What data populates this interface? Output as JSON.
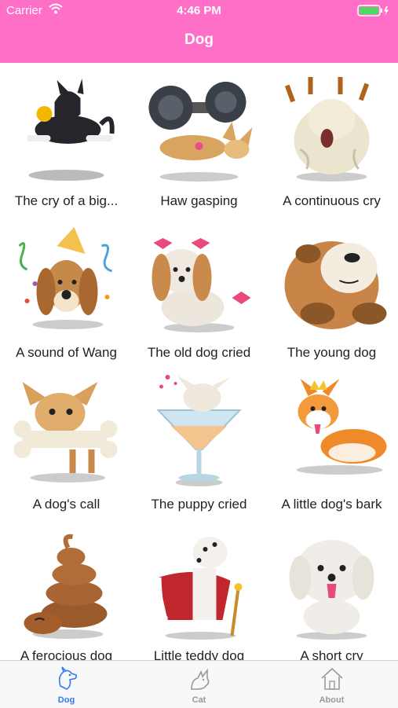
{
  "status": {
    "carrier": "Carrier",
    "time": "4:46 PM"
  },
  "nav": {
    "title": "Dog"
  },
  "items": [
    {
      "label": "The cry of a big..."
    },
    {
      "label": "Haw gasping"
    },
    {
      "label": "A continuous cry"
    },
    {
      "label": "A sound of Wang"
    },
    {
      "label": "The old dog cried"
    },
    {
      "label": "The young dog"
    },
    {
      "label": "A dog's call"
    },
    {
      "label": "The puppy cried"
    },
    {
      "label": "A little dog's bark"
    },
    {
      "label": "A ferocious dog"
    },
    {
      "label": "Little teddy dog"
    },
    {
      "label": "A short cry"
    }
  ],
  "tabs": [
    {
      "label": "Dog",
      "icon": "dog-icon",
      "active": true
    },
    {
      "label": "Cat",
      "icon": "cat-icon",
      "active": false
    },
    {
      "label": "About",
      "icon": "house-icon",
      "active": false
    }
  ],
  "colors": {
    "header": "#FF6EC7",
    "active_tab": "#3478F6",
    "inactive_tab": "#9a9a9a"
  }
}
